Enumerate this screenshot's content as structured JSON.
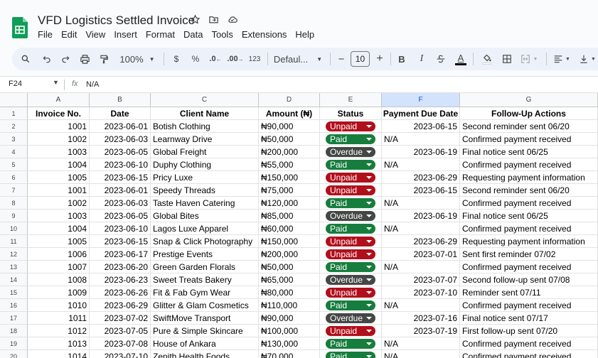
{
  "doc": {
    "title": "VFD Logistics Settled Invoice",
    "menu": [
      "File",
      "Edit",
      "View",
      "Insert",
      "Format",
      "Data",
      "Tools",
      "Extensions",
      "Help"
    ]
  },
  "toolbar": {
    "zoom": "100%",
    "currency": "$",
    "percent": "%",
    "dec_decrease": ".0←",
    "dec_increase": ".00",
    "number_format": "123",
    "font": "Defaul...",
    "font_size": "10",
    "minus": "−",
    "plus": "+",
    "bold": "B",
    "italic": "I",
    "text_color": "A"
  },
  "formula_bar": {
    "cell_ref": "F24",
    "fx": "fx",
    "value": "N/A"
  },
  "columns": [
    "A",
    "B",
    "C",
    "D",
    "E",
    "F",
    "G"
  ],
  "selected_column": "F",
  "status_colors": {
    "Paid": "#177d3e",
    "Unpaid": "#b10f1c",
    "Overdue": "#444746"
  },
  "header_row": [
    "Invoice No.",
    "Date",
    "Client Name",
    "Amount (₦)",
    "Status",
    "Payment Due Date",
    "Follow-Up Actions"
  ],
  "rows": [
    {
      "n": "2",
      "inv": "1001",
      "date": "2023-06-01",
      "client": "Botish Clothing",
      "amount": "₦90,000",
      "status": "Unpaid",
      "due": "2023-06-15",
      "action": "Second reminder sent 06/20"
    },
    {
      "n": "3",
      "inv": "1002",
      "date": "2023-06-03",
      "client": "Learnway Drive",
      "amount": "₦50,000",
      "status": "Paid",
      "due": "N/A",
      "action": "Confirmed payment received"
    },
    {
      "n": "4",
      "inv": "1003",
      "date": "2023-06-05",
      "client": "Global Freight",
      "amount": "₦200,000",
      "status": "Overdue",
      "due": "2023-06-19",
      "action": "Final notice sent 06/25"
    },
    {
      "n": "5",
      "inv": "1004",
      "date": "2023-06-10",
      "client": "Duphy Clothing",
      "amount": "₦55,000",
      "status": "Paid",
      "due": "N/A",
      "action": "Confirmed payment received"
    },
    {
      "n": "6",
      "inv": "1005",
      "date": "2023-06-15",
      "client": "Pricy Luxe",
      "amount": "₦150,000",
      "status": "Unpaid",
      "due": "2023-06-29",
      "action": "Requesting payment information"
    },
    {
      "n": "7",
      "inv": "1001",
      "date": "2023-06-01",
      "client": "Speedy Threads",
      "amount": "₦75,000",
      "status": "Unpaid",
      "due": "2023-06-15",
      "action": "Second reminder sent 06/20"
    },
    {
      "n": "8",
      "inv": "1002",
      "date": "2023-06-03",
      "client": "Taste Haven Catering",
      "amount": "₦120,000",
      "status": "Paid",
      "due": "N/A",
      "action": "Confirmed payment received"
    },
    {
      "n": "9",
      "inv": "1003",
      "date": "2023-06-05",
      "client": "Global Bites",
      "amount": "₦85,000",
      "status": "Overdue",
      "due": "2023-06-19",
      "action": "Final notice sent 06/25"
    },
    {
      "n": "10",
      "inv": "1004",
      "date": "2023-06-10",
      "client": "Lagos Luxe Apparel",
      "amount": "₦60,000",
      "status": "Paid",
      "due": "N/A",
      "action": "Confirmed payment received"
    },
    {
      "n": "11",
      "inv": "1005",
      "date": "2023-06-15",
      "client": "Snap & Click Photography",
      "amount": "₦150,000",
      "status": "Unpaid",
      "due": "2023-06-29",
      "action": "Requesting payment information"
    },
    {
      "n": "12",
      "inv": "1006",
      "date": "2023-06-17",
      "client": "Prestige Events",
      "amount": "₦200,000",
      "status": "Unpaid",
      "due": "2023-07-01",
      "action": "Sent first reminder 07/02"
    },
    {
      "n": "13",
      "inv": "1007",
      "date": "2023-06-20",
      "client": "Green Garden Florals",
      "amount": "₦50,000",
      "status": "Paid",
      "due": "N/A",
      "action": "Confirmed payment received"
    },
    {
      "n": "14",
      "inv": "1008",
      "date": "2023-06-23",
      "client": "Sweet Treats Bakery",
      "amount": "₦65,000",
      "status": "Overdue",
      "due": "2023-07-07",
      "action": "Second follow-up sent 07/08"
    },
    {
      "n": "15",
      "inv": "1009",
      "date": "2023-06-26",
      "client": "Fit & Fab Gym Wear",
      "amount": "₦80,000",
      "status": "Unpaid",
      "due": "2023-07-10",
      "action": "Reminder sent 07/11"
    },
    {
      "n": "16",
      "inv": "1010",
      "date": "2023-06-29",
      "client": "Glitter & Glam Cosmetics",
      "amount": "₦110,000",
      "status": "Paid",
      "due": "N/A",
      "action": "Confirmed payment received"
    },
    {
      "n": "17",
      "inv": "1011",
      "date": "2023-07-02",
      "client": "SwiftMove Transport",
      "amount": "₦90,000",
      "status": "Overdue",
      "due": "2023-07-16",
      "action": "Final notice sent 07/17"
    },
    {
      "n": "18",
      "inv": "1012",
      "date": "2023-07-05",
      "client": "Pure & Simple Skincare",
      "amount": "₦100,000",
      "status": "Unpaid",
      "due": "2023-07-19",
      "action": "First follow-up sent 07/20"
    },
    {
      "n": "19",
      "inv": "1013",
      "date": "2023-07-08",
      "client": "House of Ankara",
      "amount": "₦130,000",
      "status": "Paid",
      "due": "N/A",
      "action": "Confirmed payment received"
    },
    {
      "n": "20",
      "inv": "1014",
      "date": "2023-07-10",
      "client": "Zenith Health Foods",
      "amount": "₦70,000",
      "status": "Paid",
      "due": "N/A",
      "action": "Confirmed payment received"
    }
  ]
}
